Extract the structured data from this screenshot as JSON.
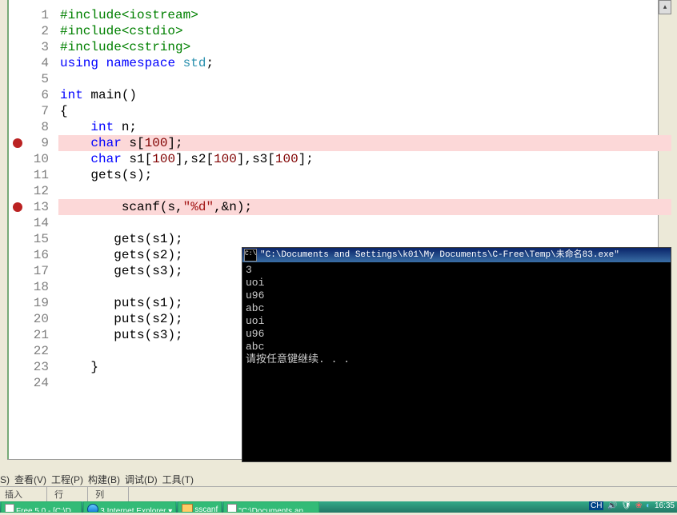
{
  "code_lines": [
    [
      [
        "pp",
        "#include<iostream>"
      ]
    ],
    [
      [
        "pp",
        "#include<cstdio>"
      ]
    ],
    [
      [
        "pp",
        "#include<cstring>"
      ]
    ],
    [
      [
        "kw",
        "using"
      ],
      [
        "id",
        " "
      ],
      [
        "kw",
        "namespace"
      ],
      [
        "id",
        " "
      ],
      [
        "ty",
        "std"
      ],
      [
        "pn",
        ";"
      ]
    ],
    [],
    [
      [
        "kw",
        "int"
      ],
      [
        "id",
        " "
      ],
      [
        "id",
        "main"
      ],
      [
        "pn",
        "()"
      ]
    ],
    [
      [
        "pn",
        "{"
      ]
    ],
    [
      [
        "id",
        "    "
      ],
      [
        "kw",
        "int"
      ],
      [
        "id",
        " n"
      ],
      [
        "pn",
        ";"
      ]
    ],
    [
      [
        "id",
        "    "
      ],
      [
        "kw",
        "char"
      ],
      [
        "id",
        " s"
      ],
      [
        "pn",
        "["
      ],
      [
        "num",
        "100"
      ],
      [
        "pn",
        "];"
      ]
    ],
    [
      [
        "id",
        "    "
      ],
      [
        "kw",
        "char"
      ],
      [
        "id",
        " s1"
      ],
      [
        "pn",
        "["
      ],
      [
        "num",
        "100"
      ],
      [
        "pn",
        "],"
      ],
      [
        "id",
        "s2"
      ],
      [
        "pn",
        "["
      ],
      [
        "num",
        "100"
      ],
      [
        "pn",
        "],"
      ],
      [
        "id",
        "s3"
      ],
      [
        "pn",
        "["
      ],
      [
        "num",
        "100"
      ],
      [
        "pn",
        "];"
      ]
    ],
    [
      [
        "id",
        "    "
      ],
      [
        "id",
        "gets"
      ],
      [
        "pn",
        "("
      ],
      [
        "id",
        "s"
      ],
      [
        "pn",
        ");"
      ]
    ],
    [],
    [
      [
        "id",
        "        "
      ],
      [
        "id",
        "scanf"
      ],
      [
        "pn",
        "("
      ],
      [
        "id",
        "s"
      ],
      [
        "pn",
        ","
      ],
      [
        "str",
        "\"%d\""
      ],
      [
        "pn",
        ",&"
      ],
      [
        "id",
        "n"
      ],
      [
        "pn",
        ");"
      ]
    ],
    [],
    [
      [
        "id",
        "       "
      ],
      [
        "id",
        "gets"
      ],
      [
        "pn",
        "("
      ],
      [
        "id",
        "s1"
      ],
      [
        "pn",
        ");"
      ]
    ],
    [
      [
        "id",
        "       "
      ],
      [
        "id",
        "gets"
      ],
      [
        "pn",
        "("
      ],
      [
        "id",
        "s2"
      ],
      [
        "pn",
        ");"
      ]
    ],
    [
      [
        "id",
        "       "
      ],
      [
        "id",
        "gets"
      ],
      [
        "pn",
        "("
      ],
      [
        "id",
        "s3"
      ],
      [
        "pn",
        ");"
      ]
    ],
    [],
    [
      [
        "id",
        "       "
      ],
      [
        "id",
        "puts"
      ],
      [
        "pn",
        "("
      ],
      [
        "id",
        "s1"
      ],
      [
        "pn",
        ");"
      ]
    ],
    [
      [
        "id",
        "       "
      ],
      [
        "id",
        "puts"
      ],
      [
        "pn",
        "("
      ],
      [
        "id",
        "s2"
      ],
      [
        "pn",
        ");"
      ]
    ],
    [
      [
        "id",
        "       "
      ],
      [
        "id",
        "puts"
      ],
      [
        "pn",
        "("
      ],
      [
        "id",
        "s3"
      ],
      [
        "pn",
        ");"
      ]
    ],
    [],
    [
      [
        "id",
        "    "
      ],
      [
        "pn",
        "}"
      ]
    ],
    []
  ],
  "breakpoints": [
    9,
    13
  ],
  "highlights": [
    9,
    13
  ],
  "console": {
    "title": "\"C:\\Documents and Settings\\k01\\My Documents\\C-Free\\Temp\\未命名83.exe\"",
    "lines": [
      "3",
      "uoi",
      "u96",
      "abc",
      "uoi",
      "u96",
      "abc",
      "请按任意键继续. . ."
    ]
  },
  "menu": [
    [
      "S",
      "查看"
    ],
    [
      "V",
      "工程"
    ],
    [
      "P",
      "构建"
    ],
    [
      "B",
      "调试"
    ],
    [
      "D",
      "工具"
    ],
    [
      "T",
      ""
    ]
  ],
  "status": {
    "mode": "插入",
    "row": "行",
    "col": "列"
  },
  "taskbar": {
    "apps": [
      "Free 5.0 - [C:\\D...",
      "3 Internet Explorer",
      "sscanf",
      "\"C:\\Documents and S..."
    ],
    "lang": "CH",
    "clock": "16:35"
  }
}
